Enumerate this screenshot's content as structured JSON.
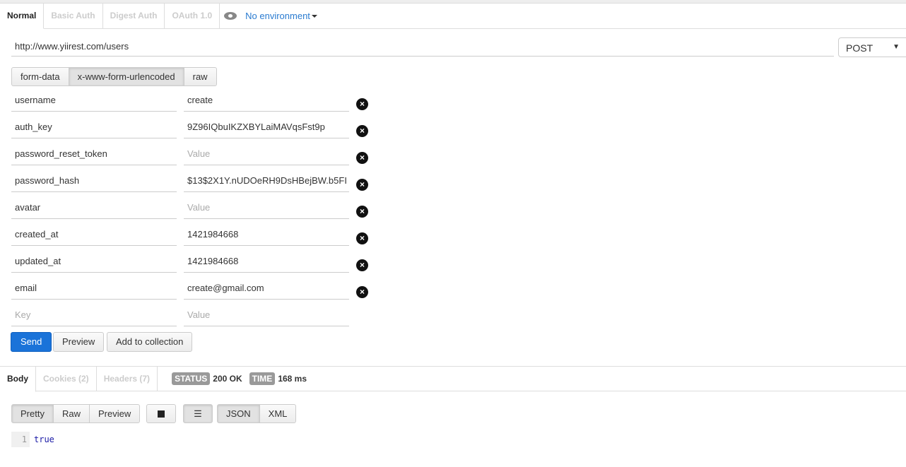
{
  "auth_tabs": [
    "Normal",
    "Basic Auth",
    "Digest Auth",
    "OAuth 1.0"
  ],
  "environment": "No environment",
  "url": "http://www.yiirest.com/users",
  "method": "POST",
  "body_modes": [
    "form-data",
    "x-www-form-urlencoded",
    "raw"
  ],
  "params": [
    {
      "key": "username",
      "value": "create"
    },
    {
      "key": "auth_key",
      "value": "9Z96IQbuIKZXBYLaiMAVqsFst9p"
    },
    {
      "key": "password_reset_token",
      "value": ""
    },
    {
      "key": "password_hash",
      "value": "$13$2X1Y.nUDOeRH9DsHBejBW.b5FI"
    },
    {
      "key": "avatar",
      "value": ""
    },
    {
      "key": "created_at",
      "value": "1421984668"
    },
    {
      "key": "updated_at",
      "value": "1421984668"
    },
    {
      "key": "email",
      "value": "create@gmail.com"
    }
  ],
  "placeholders": {
    "key": "Key",
    "value": "Value"
  },
  "actions": {
    "send": "Send",
    "preview": "Preview",
    "add": "Add to collection"
  },
  "response_tabs": [
    "Body",
    "Cookies (2)",
    "Headers (7)"
  ],
  "status": {
    "label": "STATUS",
    "value": "200 OK",
    "time_label": "TIME",
    "time": "168 ms"
  },
  "view_modes": [
    "Pretty",
    "Raw",
    "Preview"
  ],
  "formats": [
    "JSON",
    "XML"
  ],
  "response_body": {
    "line": "1",
    "text": "true"
  }
}
